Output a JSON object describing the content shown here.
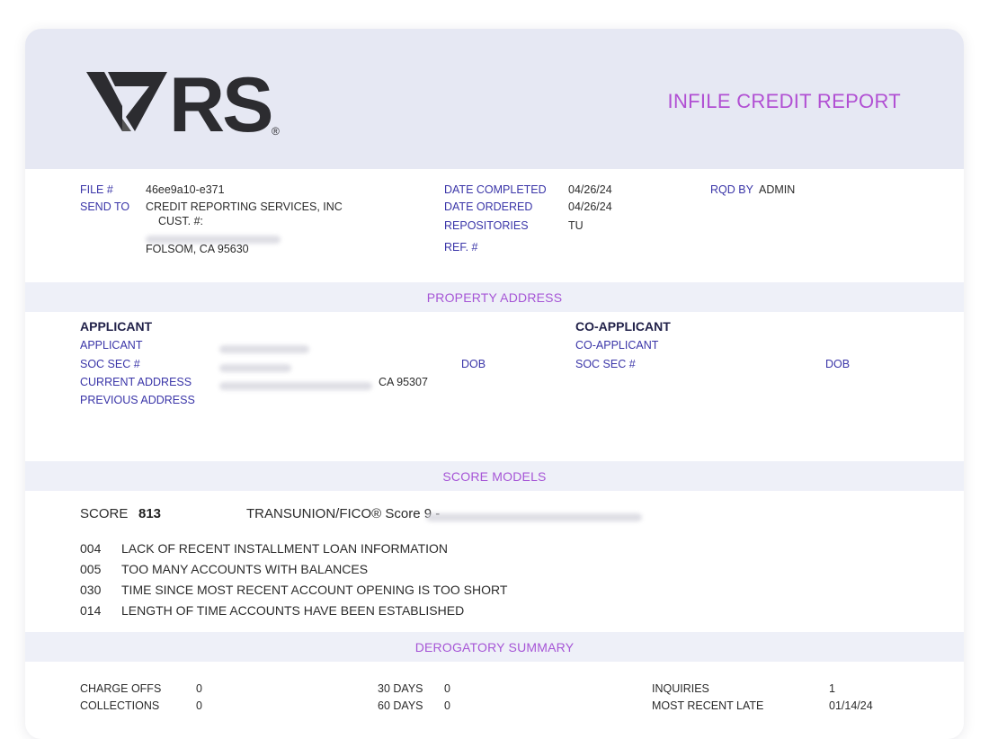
{
  "header": {
    "logo_text": "RS",
    "logo_mark": "®",
    "report_title": "INFILE CREDIT REPORT"
  },
  "file_info": {
    "file_label": "FILE #",
    "file_value": "46ee9a10-e371",
    "send_to_label": "SEND TO",
    "send_to_line1": "CREDIT REPORTING SERVICES, INC",
    "send_to_line2": "CUST. #:",
    "send_to_line4": "FOLSOM, CA 95630",
    "date_completed_label": "DATE COMPLETED",
    "date_completed_value": "04/26/24",
    "date_ordered_label": "DATE ORDERED",
    "date_ordered_value": "04/26/24",
    "repositories_label": "REPOSITORIES",
    "repositories_value": "TU",
    "ref_label": "REF. #",
    "rqd_by_label": "RQD BY",
    "rqd_by_value": "ADMIN"
  },
  "property_address": {
    "title": "PROPERTY ADDRESS",
    "applicant_heading": "APPLICANT",
    "applicant_label": "APPLICANT",
    "ssn_label": "SOC SEC #",
    "dob_label": "DOB",
    "current_address_label": "CURRENT ADDRESS",
    "current_address_suffix": "CA 95307",
    "previous_address_label": "PREVIOUS ADDRESS",
    "co_heading": "CO-APPLICANT",
    "co_applicant_label": "CO-APPLICANT",
    "co_ssn_label": "SOC SEC #",
    "co_dob_label": "DOB"
  },
  "score_models": {
    "title": "SCORE MODELS",
    "score_label": "SCORE",
    "score_value": "813",
    "model_name": "TRANSUNION/FICO® Score 9 -",
    "reasons": [
      {
        "code": "004",
        "text": "LACK OF RECENT INSTALLMENT LOAN INFORMATION"
      },
      {
        "code": "005",
        "text": "TOO MANY ACCOUNTS WITH BALANCES"
      },
      {
        "code": "030",
        "text": "TIME SINCE MOST RECENT ACCOUNT OPENING IS TOO SHORT"
      },
      {
        "code": "014",
        "text": "LENGTH OF TIME ACCOUNTS HAVE BEEN ESTABLISHED"
      }
    ]
  },
  "derogatory_summary": {
    "title": "DEROGATORY SUMMARY",
    "charge_offs_label": "CHARGE OFFS",
    "charge_offs_value": "0",
    "collections_label": "COLLECTIONS",
    "collections_value": "0",
    "days30_label": "30 DAYS",
    "days30_value": "0",
    "days60_label": "60 DAYS",
    "days60_value": "0",
    "inquiries_label": "INQUIRIES",
    "inquiries_value": "1",
    "most_recent_late_label": "MOST RECENT LATE",
    "most_recent_late_value": "01/14/24"
  },
  "colors": {
    "accent_purple": "#b14fd3",
    "label_blue": "#3a35a8",
    "header_bg": "#e6e8f3",
    "band_bg": "#eef0f8"
  }
}
